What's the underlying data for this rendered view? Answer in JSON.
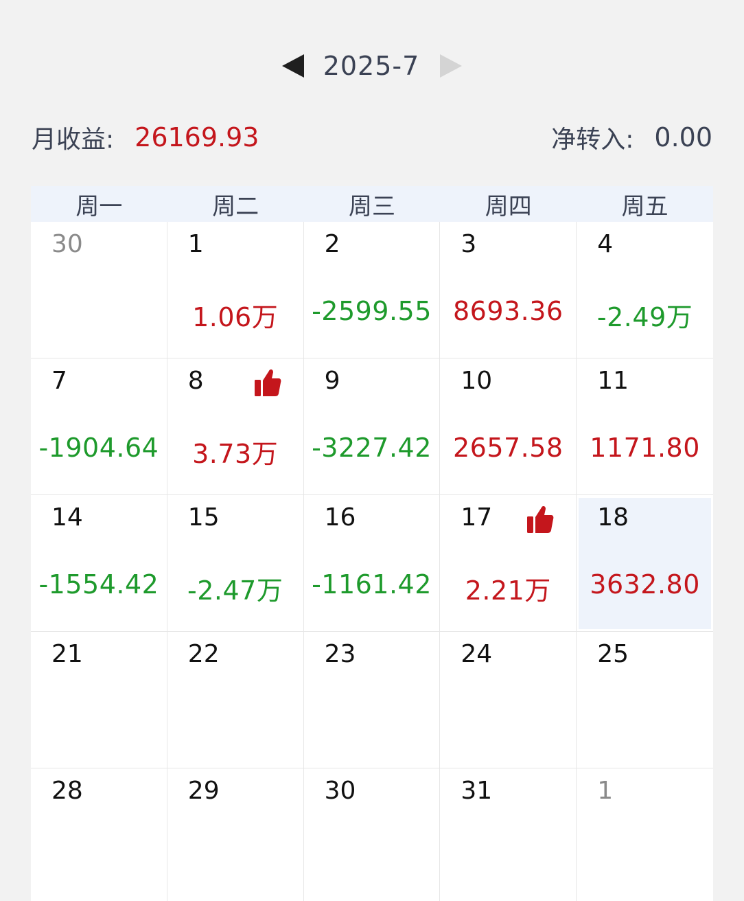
{
  "header": {
    "month": "2025-7",
    "prev_icon": "triangle-left-icon",
    "next_icon": "triangle-right-icon"
  },
  "summary": {
    "monthly_label": "月收益:",
    "monthly_value": "26169.93",
    "net_in_label": "净转入:",
    "net_in_value": "0.00"
  },
  "colors": {
    "up": "#c4161c",
    "down": "#1e9a2c",
    "header_bg": "#eef3fb"
  },
  "weekdays": [
    "周一",
    "周二",
    "周三",
    "周四",
    "周五"
  ],
  "days": [
    {
      "day": "30",
      "pnl": "",
      "dir": "",
      "other": true,
      "thumb": false,
      "today": false
    },
    {
      "day": "1",
      "pnl": "1.06万",
      "dir": "up",
      "other": false,
      "thumb": false,
      "today": false
    },
    {
      "day": "2",
      "pnl": "-2599.55",
      "dir": "down",
      "other": false,
      "thumb": false,
      "today": false
    },
    {
      "day": "3",
      "pnl": "8693.36",
      "dir": "up",
      "other": false,
      "thumb": false,
      "today": false
    },
    {
      "day": "4",
      "pnl": "-2.49万",
      "dir": "down",
      "other": false,
      "thumb": false,
      "today": false
    },
    {
      "day": "7",
      "pnl": "-1904.64",
      "dir": "down",
      "other": false,
      "thumb": false,
      "today": false
    },
    {
      "day": "8",
      "pnl": "3.73万",
      "dir": "up",
      "other": false,
      "thumb": true,
      "today": false
    },
    {
      "day": "9",
      "pnl": "-3227.42",
      "dir": "down",
      "other": false,
      "thumb": false,
      "today": false
    },
    {
      "day": "10",
      "pnl": "2657.58",
      "dir": "up",
      "other": false,
      "thumb": false,
      "today": false
    },
    {
      "day": "11",
      "pnl": "1171.80",
      "dir": "up",
      "other": false,
      "thumb": false,
      "today": false
    },
    {
      "day": "14",
      "pnl": "-1554.42",
      "dir": "down",
      "other": false,
      "thumb": false,
      "today": false
    },
    {
      "day": "15",
      "pnl": "-2.47万",
      "dir": "down",
      "other": false,
      "thumb": false,
      "today": false
    },
    {
      "day": "16",
      "pnl": "-1161.42",
      "dir": "down",
      "other": false,
      "thumb": false,
      "today": false
    },
    {
      "day": "17",
      "pnl": "2.21万",
      "dir": "up",
      "other": false,
      "thumb": true,
      "today": false
    },
    {
      "day": "18",
      "pnl": "3632.80",
      "dir": "up",
      "other": false,
      "thumb": false,
      "today": true
    },
    {
      "day": "21",
      "pnl": "",
      "dir": "",
      "other": false,
      "thumb": false,
      "today": false
    },
    {
      "day": "22",
      "pnl": "",
      "dir": "",
      "other": false,
      "thumb": false,
      "today": false
    },
    {
      "day": "23",
      "pnl": "",
      "dir": "",
      "other": false,
      "thumb": false,
      "today": false
    },
    {
      "day": "24",
      "pnl": "",
      "dir": "",
      "other": false,
      "thumb": false,
      "today": false
    },
    {
      "day": "25",
      "pnl": "",
      "dir": "",
      "other": false,
      "thumb": false,
      "today": false
    },
    {
      "day": "28",
      "pnl": "",
      "dir": "",
      "other": false,
      "thumb": false,
      "today": false
    },
    {
      "day": "29",
      "pnl": "",
      "dir": "",
      "other": false,
      "thumb": false,
      "today": false
    },
    {
      "day": "30",
      "pnl": "",
      "dir": "",
      "other": false,
      "thumb": false,
      "today": false
    },
    {
      "day": "31",
      "pnl": "",
      "dir": "",
      "other": false,
      "thumb": false,
      "today": false
    },
    {
      "day": "1",
      "pnl": "",
      "dir": "",
      "other": true,
      "thumb": false,
      "today": false
    }
  ]
}
